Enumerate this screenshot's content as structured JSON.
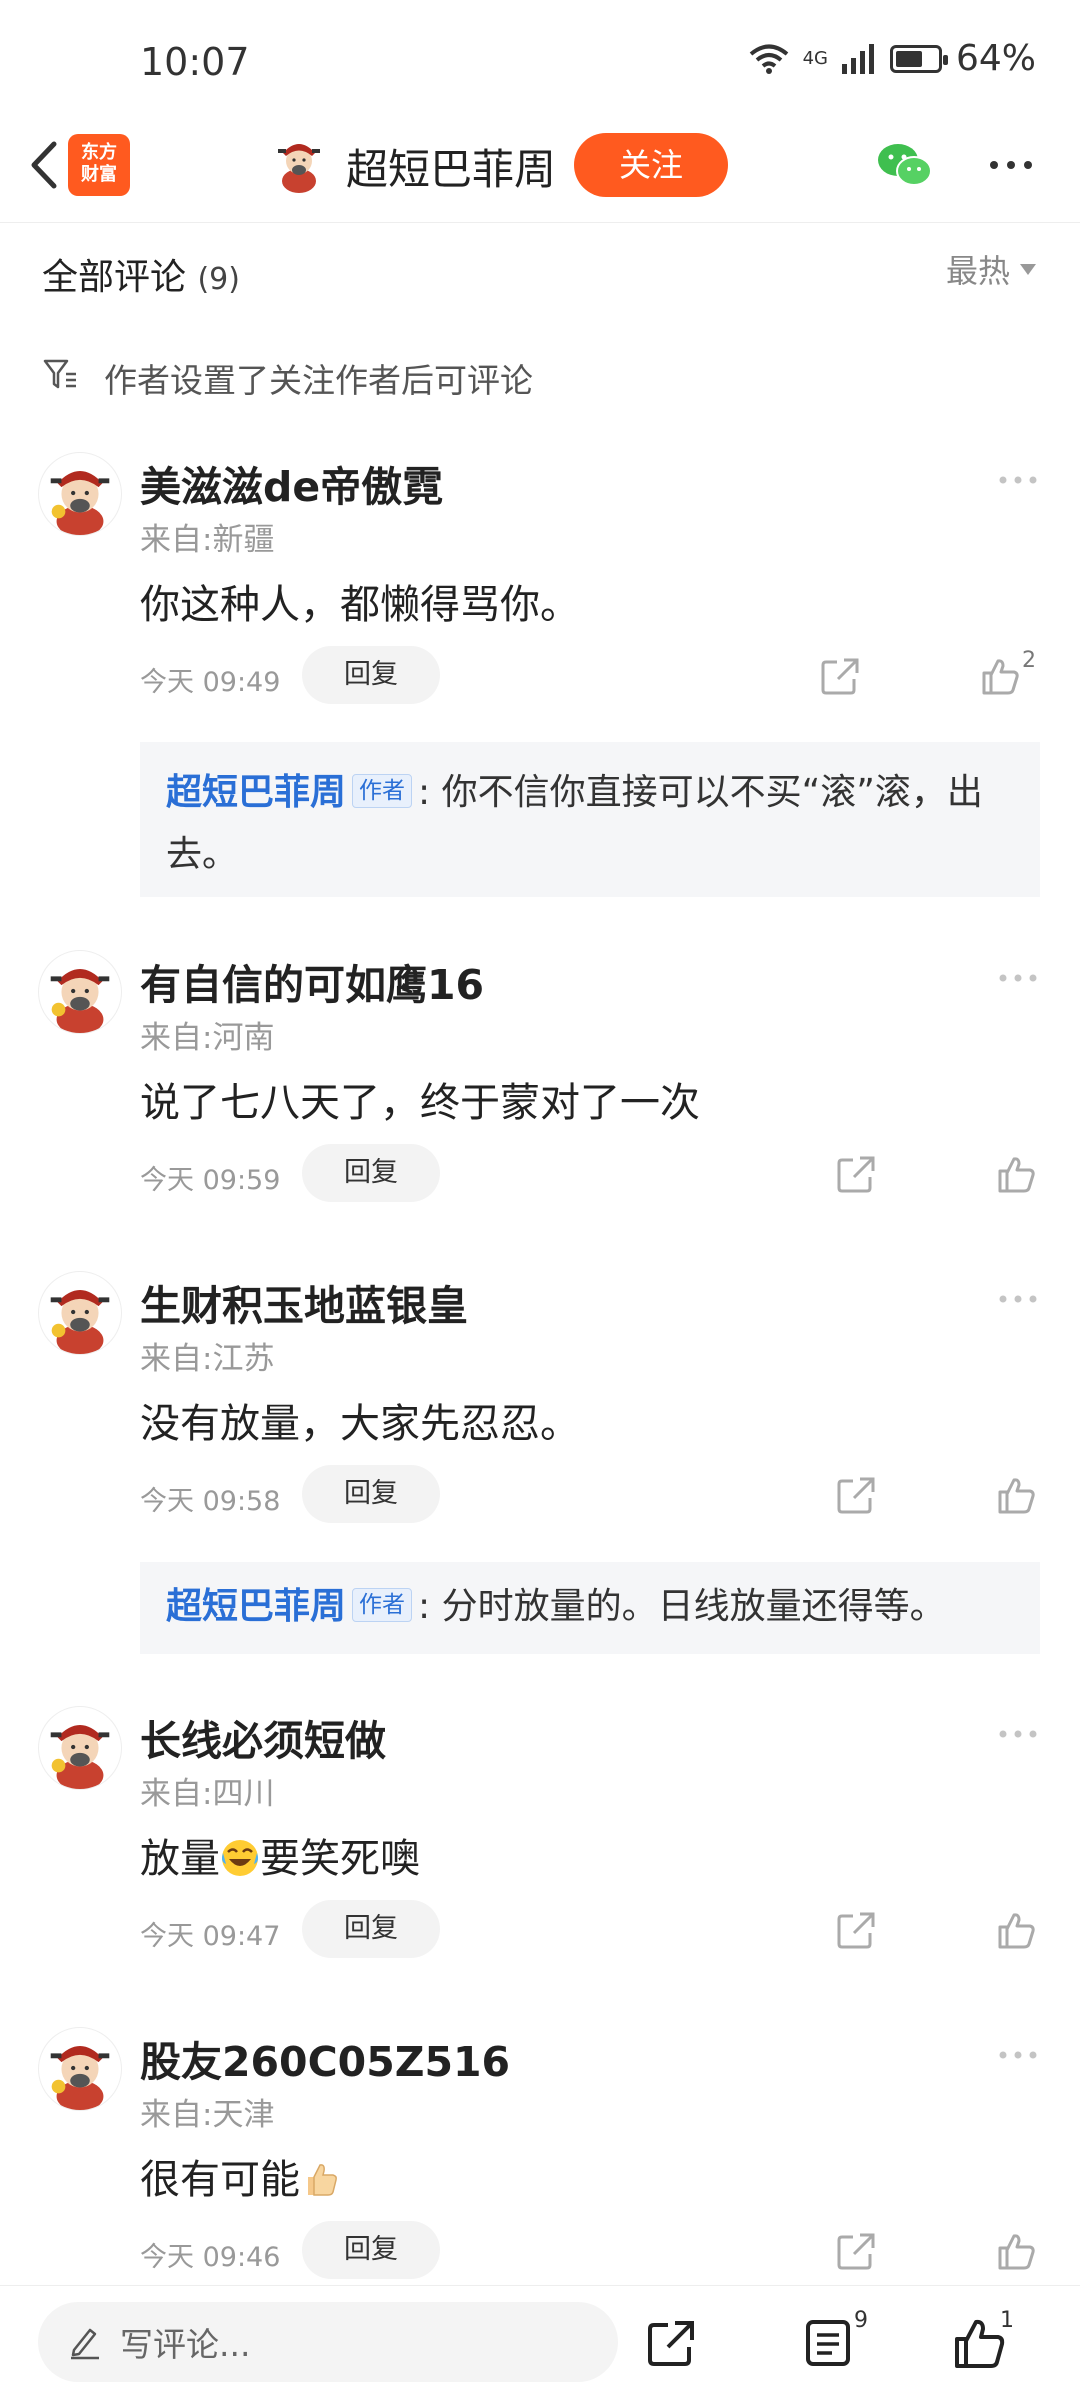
{
  "status_bar": {
    "time": "10:07",
    "network": "4G",
    "battery": "64%",
    "battery_level": 0.64
  },
  "header": {
    "logo_line1": "东方",
    "logo_line2": "财富",
    "title": "超短巴菲周",
    "follow_label": "关注"
  },
  "comments_header": {
    "label": "全部评论",
    "count": "(9)",
    "sort": "最热"
  },
  "notice": "作者设置了关注作者后可评论",
  "comments": [
    {
      "user": "美滋滋de帝傲霓",
      "location": "来自:新疆",
      "text": "你这种人，都懒得骂你。",
      "time": "今天 09:49",
      "reply_label": "回复",
      "likes": "2",
      "reply": {
        "name": "超短巴菲周",
        "tag": "作者",
        "text": ": 你不信你直接可以不买“滚”滚，出去。"
      }
    },
    {
      "user": "有自信的可如鹰16",
      "location": "来自:河南",
      "text": "说了七八天了，终于蒙对了一次",
      "time": "今天 09:59",
      "reply_label": "回复"
    },
    {
      "user": "生财积玉地蓝银皇",
      "location": "来自:江苏",
      "text": "没有放量，大家先忍忍。",
      "time": "今天 09:58",
      "reply_label": "回复",
      "reply": {
        "name": "超短巴菲周",
        "tag": "作者",
        "text": ": 分时放量的。日线放量还得等。"
      }
    },
    {
      "user": "长线必须短做",
      "location": "来自:四川",
      "text_before": "放量",
      "emoji": "laughing-tears-emoji",
      "text_after": "要笑死噢",
      "time": "今天 09:47",
      "reply_label": "回复"
    },
    {
      "user": "股友260C05Z516",
      "location": "来自:天津",
      "text_before": "很有可能",
      "emoji": "thumbs-up-emoji",
      "time": "今天 09:46",
      "reply_label": "回复"
    }
  ],
  "bottom_bar": {
    "write_placeholder": "写评论...",
    "comment_count": "9",
    "like_count": "1"
  }
}
